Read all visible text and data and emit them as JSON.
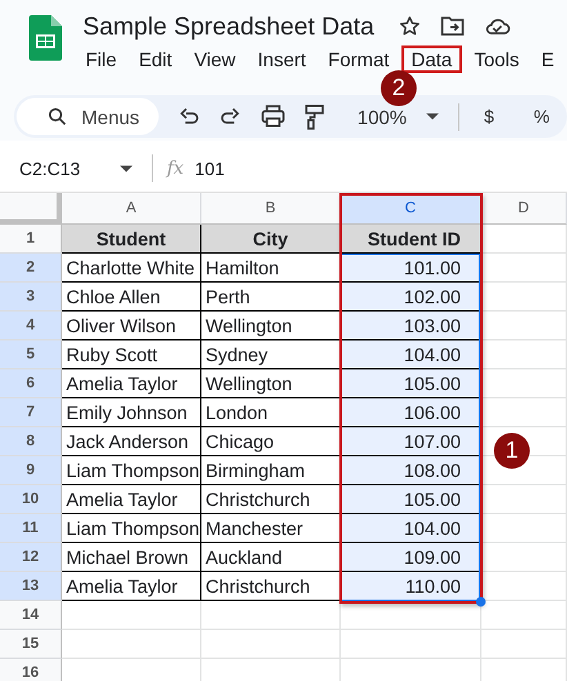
{
  "document": {
    "title": "Sample Spreadsheet Data"
  },
  "menus": [
    {
      "label": "File",
      "highlighted": false
    },
    {
      "label": "Edit",
      "highlighted": false
    },
    {
      "label": "View",
      "highlighted": false
    },
    {
      "label": "Insert",
      "highlighted": false
    },
    {
      "label": "Format",
      "highlighted": false
    },
    {
      "label": "Data",
      "highlighted": true
    },
    {
      "label": "Tools",
      "highlighted": false
    },
    {
      "label": "E",
      "highlighted": false
    }
  ],
  "toolbar": {
    "search_placeholder": "Menus",
    "zoom": "100%",
    "format_buttons": [
      "$",
      "%"
    ]
  },
  "formula_bar": {
    "name_box": "C2:C13",
    "fx_label": "fx",
    "value": "101"
  },
  "sheet": {
    "columns": [
      {
        "label": "A",
        "selected": false
      },
      {
        "label": "B",
        "selected": false
      },
      {
        "label": "C",
        "selected": true
      },
      {
        "label": "D",
        "selected": false
      }
    ],
    "rows": [
      {
        "number": "1",
        "selected": false,
        "kind": "header",
        "cells": [
          "Student",
          "City",
          "Student ID"
        ]
      },
      {
        "number": "2",
        "selected": true,
        "kind": "data",
        "cells": [
          "Charlotte White",
          "Hamilton",
          "101.00"
        ]
      },
      {
        "number": "3",
        "selected": true,
        "kind": "data",
        "cells": [
          "Chloe Allen",
          "Perth",
          "102.00"
        ]
      },
      {
        "number": "4",
        "selected": true,
        "kind": "data",
        "cells": [
          "Oliver Wilson",
          "Wellington",
          "103.00"
        ]
      },
      {
        "number": "5",
        "selected": true,
        "kind": "data",
        "cells": [
          "Ruby Scott",
          "Sydney",
          "104.00"
        ]
      },
      {
        "number": "6",
        "selected": true,
        "kind": "data",
        "cells": [
          "Amelia Taylor",
          "Wellington",
          "105.00"
        ]
      },
      {
        "number": "7",
        "selected": true,
        "kind": "data",
        "cells": [
          "Emily Johnson",
          "London",
          "106.00"
        ]
      },
      {
        "number": "8",
        "selected": true,
        "kind": "data",
        "cells": [
          "Jack Anderson",
          "Chicago",
          "107.00"
        ]
      },
      {
        "number": "9",
        "selected": true,
        "kind": "data",
        "cells": [
          "Liam Thompson",
          "Birmingham",
          "108.00"
        ]
      },
      {
        "number": "10",
        "selected": true,
        "kind": "data",
        "cells": [
          "Amelia Taylor",
          "Christchurch",
          "105.00"
        ]
      },
      {
        "number": "11",
        "selected": true,
        "kind": "data",
        "cells": [
          "Liam Thompson",
          "Manchester",
          "104.00"
        ]
      },
      {
        "number": "12",
        "selected": true,
        "kind": "data",
        "cells": [
          "Michael Brown",
          "Auckland",
          "109.00"
        ]
      },
      {
        "number": "13",
        "selected": true,
        "kind": "data",
        "cells": [
          "Amelia Taylor",
          "Christchurch",
          "110.00"
        ]
      },
      {
        "number": "14",
        "selected": false,
        "kind": "empty",
        "cells": []
      },
      {
        "number": "15",
        "selected": false,
        "kind": "empty",
        "cells": []
      },
      {
        "number": "16",
        "selected": false,
        "kind": "empty",
        "cells": []
      }
    ]
  },
  "callouts": [
    {
      "label": "1",
      "kind": "range"
    },
    {
      "label": "2",
      "kind": "menu"
    }
  ]
}
